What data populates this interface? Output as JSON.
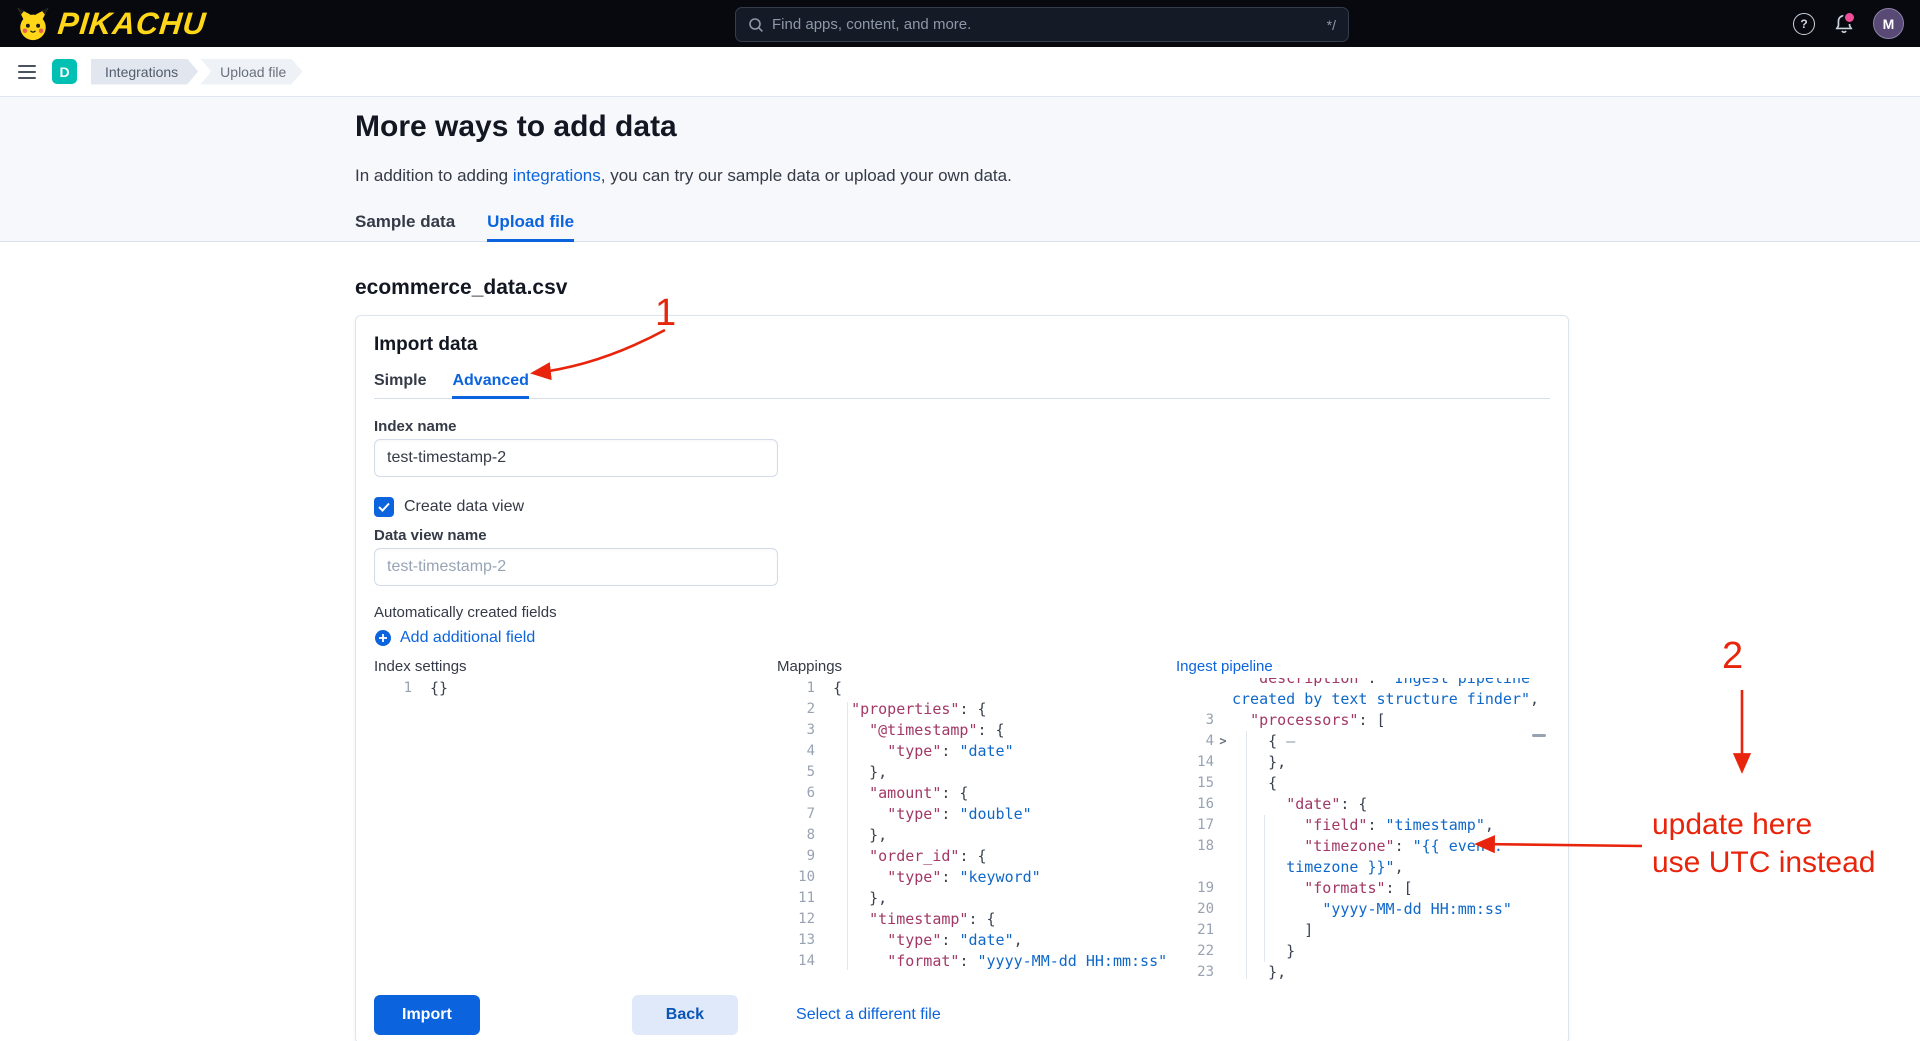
{
  "header": {
    "logo_text": "PIKACHU",
    "search_placeholder": "Find apps, content, and more.",
    "search_shortcut": "*/",
    "help_glyph": "?",
    "avatar_initial": "M",
    "brand_yellow": "#ffd718",
    "notification_pink": "#f04e98"
  },
  "breadcrumbs": {
    "space_initial": "D",
    "space_color": "#00bfb3",
    "items": [
      {
        "label": "Integrations"
      },
      {
        "label": "Upload file"
      }
    ]
  },
  "hero": {
    "title": "More ways to add data",
    "intro_before": "In addition to adding ",
    "intro_link": "integrations",
    "intro_after": ", you can try our sample data or upload your own data.",
    "tabs": [
      {
        "label": "Sample data",
        "active": false
      },
      {
        "label": "Upload file",
        "active": true
      }
    ]
  },
  "main": {
    "file_title": "ecommerce_data.csv",
    "panel": {
      "title": "Import data",
      "tabs": [
        {
          "label": "Simple",
          "active": false
        },
        {
          "label": "Advanced",
          "active": true
        }
      ],
      "index_name": {
        "label": "Index name",
        "value": "test-timestamp-2"
      },
      "create_data_view": {
        "label": "Create data view",
        "checked": true
      },
      "data_view_name": {
        "label": "Data view name",
        "placeholder": "test-timestamp-2"
      },
      "auto_fields_label": "Automatically created fields",
      "add_field_label": "Add additional field",
      "buttons": {
        "import": "Import",
        "back": "Back",
        "different_file": "Select a different file"
      }
    }
  },
  "editors": {
    "index_settings": {
      "label": "Index settings",
      "lines": [
        {
          "n": "1",
          "t": [
            [
              "{}",
              "p"
            ]
          ]
        }
      ]
    },
    "mappings": {
      "label": "Mappings",
      "lines": [
        {
          "n": "1",
          "t": [
            [
              "{",
              "p"
            ]
          ]
        },
        {
          "n": "2",
          "t": [
            [
              "  ",
              "p"
            ],
            [
              "\"properties\"",
              "k"
            ],
            [
              ": {",
              "p"
            ]
          ]
        },
        {
          "n": "3",
          "t": [
            [
              "    ",
              "p"
            ],
            [
              "\"@timestamp\"",
              "k"
            ],
            [
              ": {",
              "p"
            ]
          ]
        },
        {
          "n": "4",
          "t": [
            [
              "      ",
              "p"
            ],
            [
              "\"type\"",
              "k"
            ],
            [
              ": ",
              "p"
            ],
            [
              "\"date\"",
              "s"
            ]
          ]
        },
        {
          "n": "5",
          "t": [
            [
              "    },",
              "p"
            ]
          ]
        },
        {
          "n": "6",
          "t": [
            [
              "    ",
              "p"
            ],
            [
              "\"amount\"",
              "k"
            ],
            [
              ": {",
              "p"
            ]
          ]
        },
        {
          "n": "7",
          "t": [
            [
              "      ",
              "p"
            ],
            [
              "\"type\"",
              "k"
            ],
            [
              ": ",
              "p"
            ],
            [
              "\"double\"",
              "s"
            ]
          ]
        },
        {
          "n": "8",
          "t": [
            [
              "    },",
              "p"
            ]
          ]
        },
        {
          "n": "9",
          "t": [
            [
              "    ",
              "p"
            ],
            [
              "\"order_id\"",
              "k"
            ],
            [
              ": {",
              "p"
            ]
          ]
        },
        {
          "n": "10",
          "t": [
            [
              "      ",
              "p"
            ],
            [
              "\"type\"",
              "k"
            ],
            [
              ": ",
              "p"
            ],
            [
              "\"keyword\"",
              "s"
            ]
          ]
        },
        {
          "n": "11",
          "t": [
            [
              "    },",
              "p"
            ]
          ]
        },
        {
          "n": "12",
          "t": [
            [
              "    ",
              "p"
            ],
            [
              "\"timestamp\"",
              "k"
            ],
            [
              ": {",
              "p"
            ]
          ]
        },
        {
          "n": "13",
          "t": [
            [
              "      ",
              "p"
            ],
            [
              "\"type\"",
              "k"
            ],
            [
              ": ",
              "p"
            ],
            [
              "\"date\"",
              "s"
            ],
            [
              ",",
              "p"
            ]
          ]
        },
        {
          "n": "14",
          "t": [
            [
              "      ",
              "p"
            ],
            [
              "\"format\"",
              "k"
            ],
            [
              ": ",
              "p"
            ],
            [
              "\"yyyy-MM-dd HH:mm:ss\"",
              "s"
            ]
          ]
        }
      ]
    },
    "ingest_pipeline": {
      "label": "Ingest pipeline",
      "lines": [
        {
          "n": "",
          "clip": true,
          "t": [
            [
              "  ",
              "p"
            ],
            [
              "\"description\"",
              "k"
            ],
            [
              ": ",
              "p"
            ],
            [
              "\"Ingest pipeline",
              "s"
            ]
          ]
        },
        {
          "n": "",
          "t": [
            [
              "created by text structure finder\"",
              "s"
            ],
            [
              ",",
              "p"
            ]
          ]
        },
        {
          "n": "3",
          "t": [
            [
              "  ",
              "p"
            ],
            [
              "\"processors\"",
              "k"
            ],
            [
              ": [",
              "p"
            ]
          ]
        },
        {
          "n": "4",
          "fold": true,
          "t": [
            [
              "    { ",
              "p"
            ],
            [
              "—",
              "d"
            ]
          ]
        },
        {
          "n": "14",
          "t": [
            [
              "    },",
              "p"
            ]
          ]
        },
        {
          "n": "15",
          "t": [
            [
              "    {",
              "p"
            ]
          ]
        },
        {
          "n": "16",
          "t": [
            [
              "      ",
              "p"
            ],
            [
              "\"date\"",
              "k"
            ],
            [
              ": {",
              "p"
            ]
          ]
        },
        {
          "n": "17",
          "t": [
            [
              "        ",
              "p"
            ],
            [
              "\"field\"",
              "k"
            ],
            [
              ": ",
              "p"
            ],
            [
              "\"timestamp\"",
              "s"
            ],
            [
              ",",
              "p"
            ]
          ]
        },
        {
          "n": "18",
          "t": [
            [
              "        ",
              "p"
            ],
            [
              "\"timezone\"",
              "k"
            ],
            [
              ": ",
              "p"
            ],
            [
              "\"{{ event.",
              "s"
            ]
          ]
        },
        {
          "n": "",
          "t": [
            [
              "      ",
              "p"
            ],
            [
              "timezone }}\"",
              "s"
            ],
            [
              ",",
              "p"
            ]
          ]
        },
        {
          "n": "19",
          "t": [
            [
              "        ",
              "p"
            ],
            [
              "\"formats\"",
              "k"
            ],
            [
              ": [",
              "p"
            ]
          ]
        },
        {
          "n": "20",
          "t": [
            [
              "          ",
              "p"
            ],
            [
              "\"yyyy-MM-dd HH:mm:ss\"",
              "s"
            ]
          ]
        },
        {
          "n": "21",
          "t": [
            [
              "        ]",
              "p"
            ]
          ]
        },
        {
          "n": "22",
          "t": [
            [
              "      }",
              "p"
            ]
          ]
        },
        {
          "n": "23",
          "t": [
            [
              "    },",
              "p"
            ]
          ]
        }
      ]
    }
  },
  "annotations": {
    "color": "#e8250c",
    "step_1": "1",
    "step_2": "2",
    "note_line_1": "update here",
    "note_line_2": "use UTC instead"
  },
  "theme": {
    "primary_blue": "#0b64dd"
  }
}
